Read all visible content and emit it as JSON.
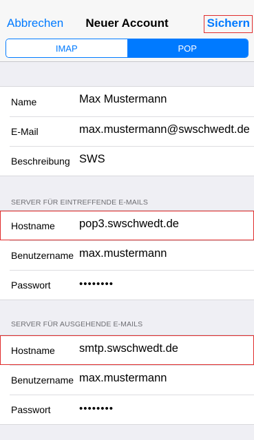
{
  "navbar": {
    "cancel_label": "Abbrechen",
    "title": "Neuer Account",
    "save_label": "Sichern"
  },
  "segments": {
    "imap_label": "IMAP",
    "pop_label": "POP",
    "selected": "POP"
  },
  "account": {
    "name_label": "Name",
    "name_value": "Max Mustermann",
    "email_label": "E-Mail",
    "email_value": "max.mustermann@swschwedt.de",
    "description_label": "Beschreibung",
    "description_value": "SWS"
  },
  "incoming": {
    "header": "SERVER FÜR EINTREFFENDE E-MAILS",
    "hostname_label": "Hostname",
    "hostname_value": "pop3.swschwedt.de",
    "username_label": "Benutzername",
    "username_value": "max.mustermann",
    "password_label": "Passwort",
    "password_value": "••••••••"
  },
  "outgoing": {
    "header": "SERVER FÜR AUSGEHENDE E-MAILS",
    "hostname_label": "Hostname",
    "hostname_value": "smtp.swschwedt.de",
    "username_label": "Benutzername",
    "username_value": "max.mustermann",
    "password_label": "Passwort",
    "password_value": "••••••••"
  },
  "colors": {
    "accent": "#007aff",
    "highlight": "#e02b2b",
    "background": "#efeff4"
  }
}
